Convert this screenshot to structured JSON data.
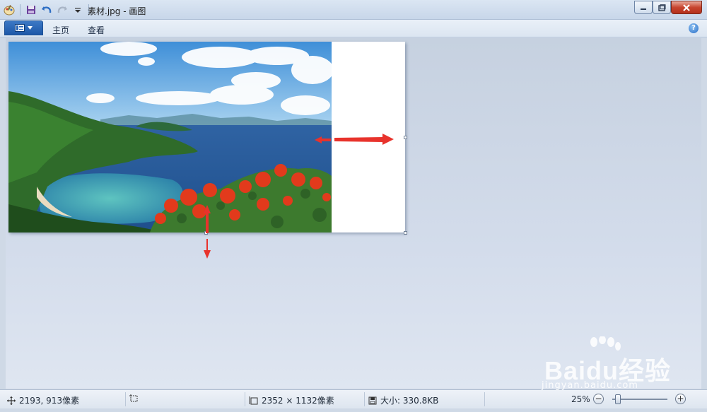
{
  "window": {
    "title": "素材.jpg - 画图"
  },
  "ribbon": {
    "tabs": [
      {
        "label": "主页"
      },
      {
        "label": "查看"
      }
    ],
    "help_label": "?"
  },
  "statusbar": {
    "cursor_position": "2193, 913像素",
    "image_dimensions": "2352 × 1132像素",
    "file_size": "大小: 330.8KB",
    "zoom": "25%",
    "zoom_fraction": 0.1
  },
  "watermark": {
    "logo_text": "Baidu经验",
    "url": "jingyan.baidu.com"
  },
  "colors": {
    "annotation_arrow": "#e8332c",
    "file_menu": "#2a66b8",
    "close_button": "#c7452f"
  }
}
